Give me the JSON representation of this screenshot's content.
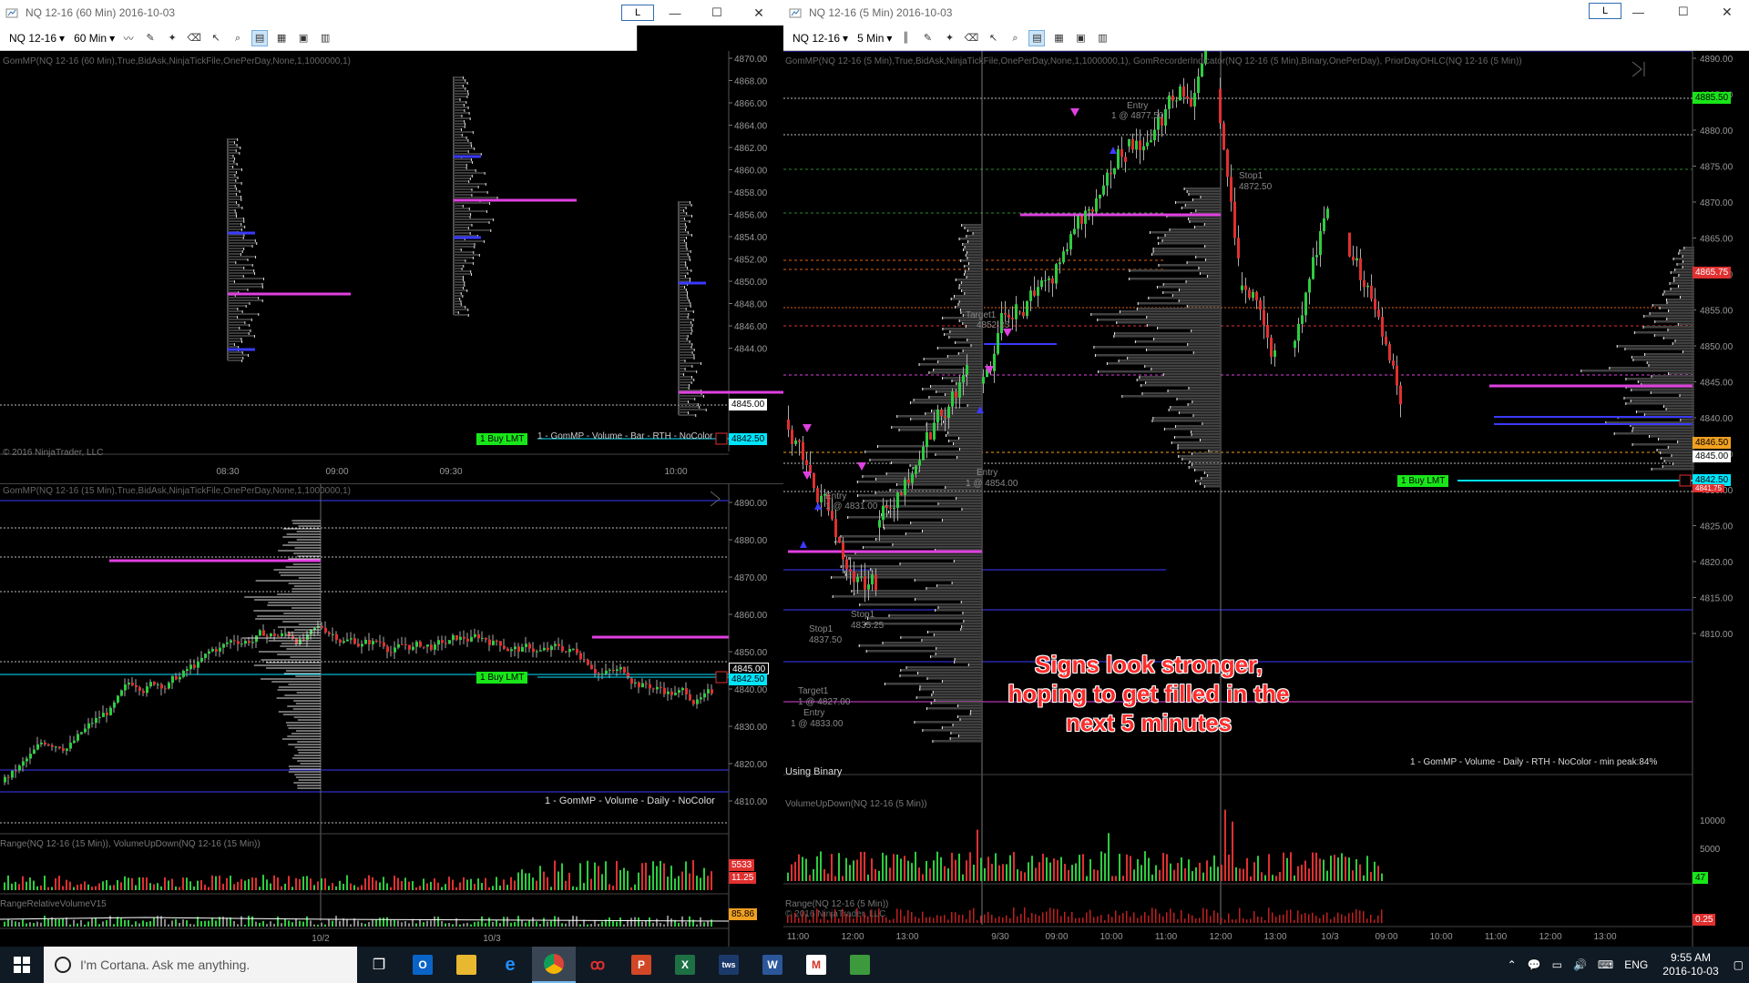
{
  "left_window": {
    "title": "NQ 12-16 (60 Min)  2016-10-03",
    "l_button": "L",
    "instrument": "NQ 12-16",
    "interval": "60 Min",
    "top_chart": {
      "indicator_label": "GomMP(NQ 12-16 (60 Min),True,BidAsk,NinjaTickFile,OnePerDay,None,1,1000000,1)",
      "copyright": "© 2016 NinjaTrader, LLC",
      "order_label": "1  Buy LMT",
      "legend": "1 - GomMP - Volume - Bar - RTH - NoColor",
      "price_axis": [
        "4870.00",
        "4868.00",
        "4866.00",
        "4864.00",
        "4862.00",
        "4860.00",
        "4858.00",
        "4856.00",
        "4854.00",
        "4852.00",
        "4850.00",
        "4848.00",
        "4846.00",
        "4844.00"
      ],
      "tag_last": "4845.00",
      "tag_order": "4842.50",
      "time_axis": [
        "08:30",
        "09:00",
        "09:30",
        "10:00"
      ]
    },
    "bottom_chart": {
      "indicator_label": "GomMP(NQ 12-16 (15 Min),True,BidAsk,NinjaTickFile,OnePerDay,None,1,1000000,1)",
      "order_label": "1  Buy LMT",
      "legend": "1 - GomMP - Volume - Daily - NoColor",
      "price_axis": [
        "4890.00",
        "4880.00",
        "4870.00",
        "4860.00",
        "4850.00",
        "4840.00",
        "4830.00",
        "4820.00",
        "4810.00"
      ],
      "tag_last": "4845.00",
      "tag_order": "4842.50",
      "range_label": "Range(NQ 12-16 (15 Min)), VolumeUpDown(NQ 12-16 (15 Min))",
      "range_tag1": "5533",
      "range_tag2": "11.25",
      "relvol_label": "RangeRelativeVolumeV15",
      "relvol_tag": "85.86",
      "time_axis": [
        "10/2",
        "10/3"
      ]
    }
  },
  "right_window": {
    "title": "NQ 12-16 (5 Min)  2016-10-03",
    "l_button": "L",
    "instrument": "NQ 12-16",
    "interval": "5 Min",
    "indicator_label": "GomMP(NQ 12-16 (5 Min),True,BidAsk,NinjaTickFile,OnePerDay,None,1,1000000,1), GomRecorderIndicator(NQ 12-16 (5 Min),Binary,OnePerDay), PriorDayOHLC(NQ 12-16 (5 Min))",
    "price_axis": [
      "4890.00",
      "4885.00",
      "4880.00",
      "4875.00",
      "4870.00",
      "4865.00",
      "4860.00",
      "4855.00",
      "4850.00",
      "4845.00",
      "4840.00",
      "4835.00",
      "4830.00",
      "4825.00",
      "4820.00",
      "4815.00",
      "4810.00"
    ],
    "tag_high": "4885.50",
    "tag_red": "4865.75",
    "tag_orange": "4846.50",
    "tag_last": "4845.00",
    "tag_order": "4842.50",
    "tag_red2": "4841.75",
    "order_label": "1  Buy LMT",
    "trade_labels": {
      "entry_top": "Entry",
      "entry_top_fill": "1 @ 4877.50",
      "stop_top": "Stop1",
      "stop_top_price": "4872.50",
      "target_mid": "Target1",
      "target_mid_price": "4852.25",
      "entry_mid": "Entry",
      "entry_mid_price": "1 @ 4854.00",
      "entry_low": "Entry",
      "entry_low_price": "1 @ 4831.00",
      "stop_low1": "Stop1",
      "stop_low1_price": "4835.25",
      "stop_low2": "Stop1",
      "stop_low2_price": "4837.50",
      "target_low": "Target1",
      "target_low_price": "1 @ 4827.00",
      "entry_bottom": "Entry",
      "entry_bottom_price": "1 @ 4833.00"
    },
    "annotation": "Signs look stronger, hoping to get filled in the next 5 minutes",
    "using_binary": "Using Binary",
    "legend": "1 - GomMP - Volume - Daily - RTH - NoColor - min peak:84%",
    "volume_label": "VolumeUpDown(NQ 12-16 (5 Min))",
    "volume_axis": [
      "10000",
      "5000"
    ],
    "volume_tag": "47",
    "range_label": "Range(NQ 12-16 (5 Min))",
    "copyright": "© 2016 NinjaTrader, LLC",
    "range_tag": "0.25",
    "time_axis": [
      "11:00",
      "12:00",
      "13:00",
      "9/30",
      "09:00",
      "10:00",
      "11:00",
      "12:00",
      "13:00",
      "10/3",
      "09:00",
      "10:00",
      "11:00",
      "12:00",
      "13:00"
    ]
  },
  "taskbar": {
    "search_placeholder": "I'm Cortana. Ask me anything.",
    "language": "ENG",
    "time": "9:55 AM",
    "date": "2016-10-03"
  },
  "colors": {
    "bull": "#2ecc40",
    "bear": "#e03030",
    "poc": "#e040e0",
    "level_blue": "#3a3aff",
    "order_green": "#19e619",
    "cyan": "#00e5ff"
  }
}
